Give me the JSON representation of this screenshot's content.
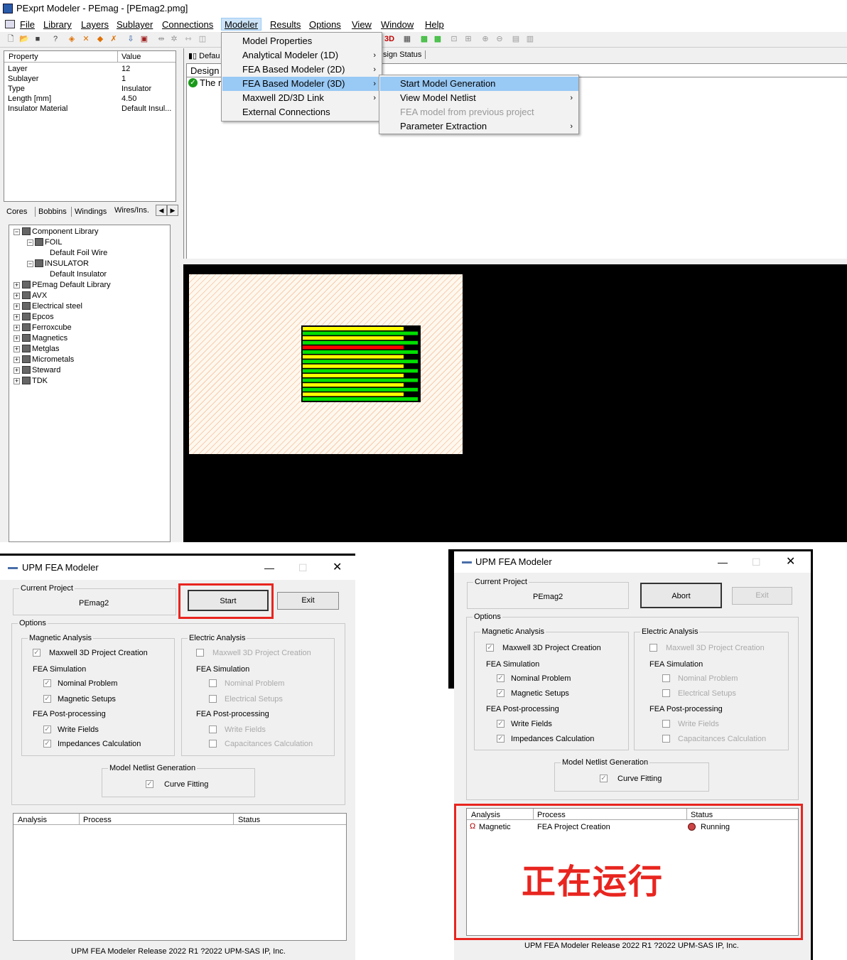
{
  "app": {
    "title": "PExprt Modeler - PEmag - [PEmag2.pmg]",
    "menus": [
      "File",
      "Library",
      "Layers",
      "Sublayer",
      "Connections",
      "Modeler",
      "Results",
      "Options",
      "View",
      "Window",
      "Help"
    ],
    "toolbar_3d": "3D",
    "props": {
      "header_property": "Property",
      "header_value": "Value",
      "rows": [
        {
          "k": "Layer",
          "v": "12"
        },
        {
          "k": "Sublayer",
          "v": "1"
        },
        {
          "k": "Type",
          "v": "Insulator"
        },
        {
          "k": "Length [mm]",
          "v": "4.50"
        },
        {
          "k": "Insulator Material",
          "v": "Default Insul..."
        }
      ]
    },
    "tabs": [
      "Cores",
      "Bobbins",
      "Windings",
      "Wires/Ins."
    ],
    "tree": {
      "component_library": "Component Library",
      "foil": "FOIL",
      "default_foil": "Default Foil Wire",
      "insulator": "INSULATOR",
      "default_insulator": "Default Insulator",
      "libs": [
        "PEmag Default Library",
        "AVX",
        "Electrical steel",
        "Epcos",
        "Ferroxcube",
        "Magnetics",
        "Metglas",
        "Micrometals",
        "Steward",
        "TDK"
      ]
    },
    "right_top": {
      "tab_default": "Defau",
      "tab_design_status": "sign Status",
      "design": "Design",
      "the_r": "The r"
    },
    "modeler_menu": [
      "Model Properties",
      "Analytical Modeler (1D)",
      "FEA Based Modeler (2D)",
      "FEA Based Modeler (3D)",
      "Maxwell 2D/3D Link",
      "External Connections"
    ],
    "submenu": [
      "Start Model Generation",
      "View Model Netlist",
      "FEA model from previous project",
      "Parameter Extraction"
    ]
  },
  "dialog_left": {
    "title": "UPM FEA Modeler",
    "current_project_label": "Current Project",
    "project_name": "PEmag2",
    "start": "Start",
    "exit": "Exit",
    "options": "Options",
    "magnetic": "Magnetic Analysis",
    "electric": "Electric Analysis",
    "maxwell": "Maxwell 3D Project Creation",
    "fea_sim": "FEA Simulation",
    "nominal": "Nominal Problem",
    "mag_setups": "Magnetic Setups",
    "elec_setups": "Electrical Setups",
    "fea_post": "FEA Post-processing",
    "write_fields": "Write Fields",
    "impedances": "Impedances Calculation",
    "capacitances": "Capacitances Calculation",
    "netlist": "Model Netlist Generation",
    "curve": "Curve Fitting",
    "col_analysis": "Analysis",
    "col_process": "Process",
    "col_status": "Status",
    "footer": "UPM FEA Modeler Release 2022 R1 ?2022 UPM-SAS IP, Inc."
  },
  "dialog_right": {
    "title": "UPM FEA Modeler",
    "current_project_label": "Current Project",
    "project_name": "PEmag2",
    "abort": "Abort",
    "exit": "Exit",
    "options": "Options",
    "magnetic": "Magnetic Analysis",
    "electric": "Electric Analysis",
    "maxwell": "Maxwell 3D Project Creation",
    "fea_sim": "FEA Simulation",
    "nominal": "Nominal Problem",
    "mag_setups": "Magnetic Setups",
    "elec_setups": "Electrical Setups",
    "fea_post": "FEA Post-processing",
    "write_fields": "Write Fields",
    "impedances": "Impedances Calculation",
    "capacitances": "Capacitances Calculation",
    "netlist": "Model Netlist Generation",
    "curve": "Curve Fitting",
    "col_analysis": "Analysis",
    "col_process": "Process",
    "col_status": "Status",
    "row_analysis": "Magnetic",
    "row_process": "FEA Project Creation",
    "row_status": "Running",
    "running_cn": "正在运行",
    "footer": "UPM FEA Modeler Release 2022 R1 ?2022 UPM-SAS IP, Inc."
  },
  "colors": {
    "highlight": "#99c9f5",
    "red_annotation": "#e8251f",
    "winding_yellow": "#ffff00",
    "winding_green": "#00e000",
    "winding_red": "#ff0000"
  }
}
